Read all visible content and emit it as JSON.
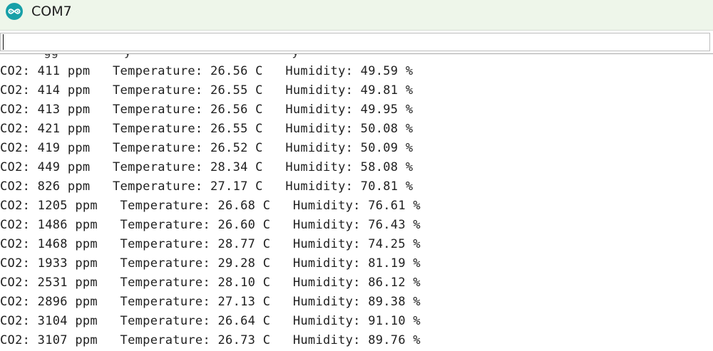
{
  "window": {
    "title": "COM7",
    "icon": "arduino-infinity-icon"
  },
  "send_input": {
    "value": ""
  },
  "serial_output": {
    "lines": [
      "CO2: 411 ppm   Temperature: 26.56 C   Humidity: 49.59 %",
      "CO2: 414 ppm   Temperature: 26.55 C   Humidity: 49.81 %",
      "CO2: 413 ppm   Temperature: 26.56 C   Humidity: 49.95 %",
      "CO2: 421 ppm   Temperature: 26.55 C   Humidity: 50.08 %",
      "CO2: 419 ppm   Temperature: 26.52 C   Humidity: 50.09 %",
      "CO2: 449 ppm   Temperature: 28.34 C   Humidity: 58.08 %",
      "CO2: 826 ppm   Temperature: 27.17 C   Humidity: 70.81 %",
      "CO2: 1205 ppm   Temperature: 26.68 C   Humidity: 76.61 %",
      "CO2: 1486 ppm   Temperature: 26.60 C   Humidity: 76.43 %",
      "CO2: 1468 ppm   Temperature: 28.77 C   Humidity: 74.25 %",
      "CO2: 1933 ppm   Temperature: 29.28 C   Humidity: 81.19 %",
      "CO2: 2531 ppm   Temperature: 28.10 C   Humidity: 86.12 %",
      "CO2: 2896 ppm   Temperature: 27.13 C   Humidity: 89.38 %",
      "CO2: 3104 ppm   Temperature: 26.64 C   Humidity: 91.10 %",
      "CO2: 3107 ppm   Temperature: 26.73 C   Humidity: 89.76 %"
    ]
  }
}
